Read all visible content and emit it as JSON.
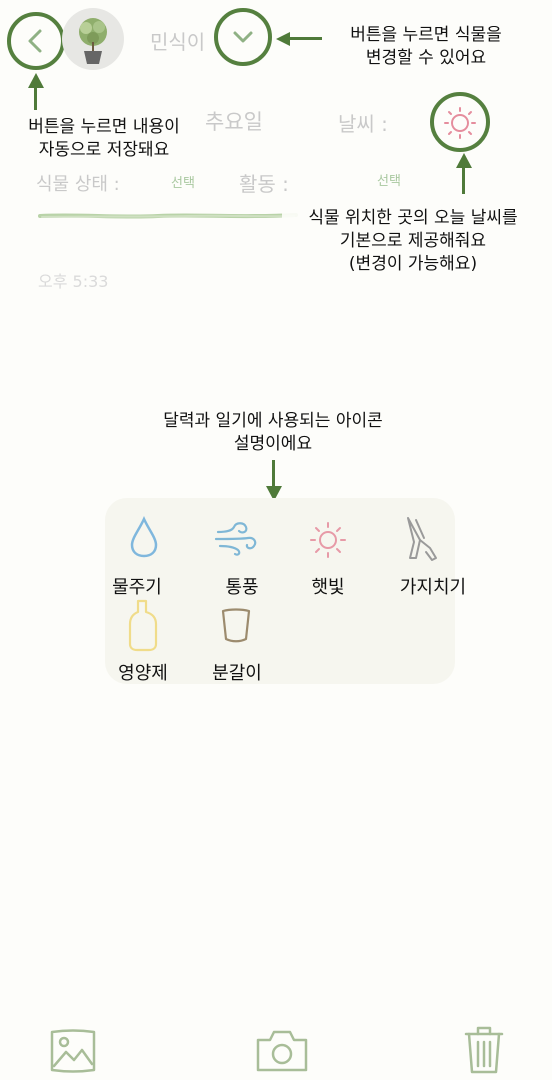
{
  "header": {
    "plant_name": "민식이",
    "partial_text": "추요일"
  },
  "weather": {
    "label": "날씨 :"
  },
  "fields": {
    "plant_state_label": "식물 상태 :",
    "plant_state_value": "선택",
    "activity_label": "활동 :",
    "activity_value": "선택"
  },
  "time": {
    "text": "오후 5:33"
  },
  "annotations": {
    "back_button": [
      "버튼을 누르면 내용이",
      "자동으로 저장돼요"
    ],
    "plant_dropdown": [
      "버튼을 누르면 식물을",
      "변경할 수 있어요"
    ],
    "weather": [
      "식물 위치한 곳의 오늘 날씨를",
      "기본으로 제공해줘요",
      "(변경이 가능해요)"
    ],
    "legend": [
      "달력과 일기에 사용되는 아이콘",
      "설명이에요"
    ]
  },
  "legend": {
    "items": [
      {
        "label": "물주기",
        "icon": "water-drop-icon",
        "color": "#7fb7dd"
      },
      {
        "label": "통풍",
        "icon": "wind-icon",
        "color": "#7fb7d6"
      },
      {
        "label": "햇빛",
        "icon": "sun-icon",
        "color": "#e79aa7"
      },
      {
        "label": "가지치기",
        "icon": "scissors-icon",
        "color": "#9a9a9a"
      },
      {
        "label": "영양제",
        "icon": "nutrient-bottle-icon",
        "color": "#f0dc8a"
      },
      {
        "label": "분갈이",
        "icon": "pot-icon",
        "color": "#9c8b6e"
      }
    ]
  },
  "toolbar": {
    "items": [
      "gallery-icon",
      "camera-icon",
      "trash-icon"
    ]
  },
  "colors": {
    "accent_green": "#55803f",
    "faded_text": "#c9c9c9",
    "background": "#fdfdfa"
  }
}
